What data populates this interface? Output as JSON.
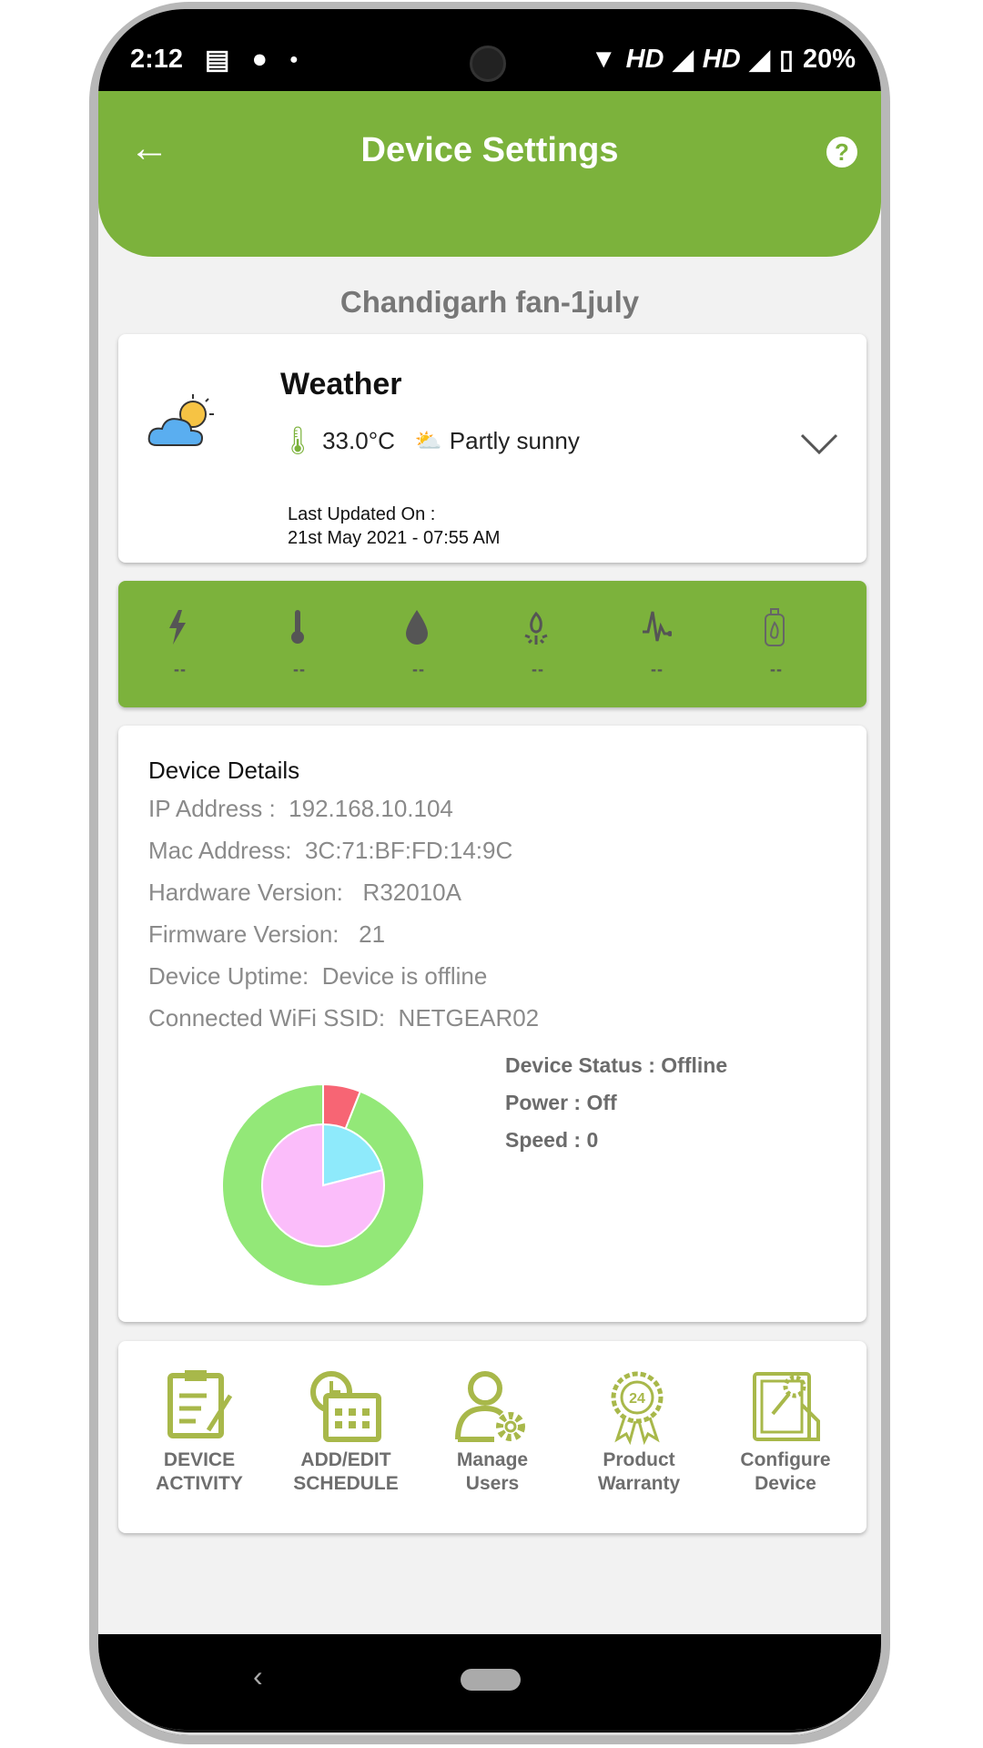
{
  "status_bar": {
    "time": "2:12",
    "network": "HD",
    "network2": "HD",
    "battery": "20%"
  },
  "header": {
    "title": "Device Settings",
    "back_icon": "arrow-left-icon",
    "help_icon": "help-icon",
    "help_label": "?",
    "back_label": "←"
  },
  "device_name": "Chandigarh fan-1july",
  "weather": {
    "title": "Weather",
    "temperature": "33.0°C",
    "condition": "Partly sunny",
    "updated_label": "Last Updated On :",
    "updated_value": "21st May 2021 - 07:55 AM"
  },
  "sensors": [
    {
      "icon": "lightning-icon",
      "value": "--"
    },
    {
      "icon": "thermometer-icon",
      "value": "--"
    },
    {
      "icon": "water-drop-icon",
      "value": "--"
    },
    {
      "icon": "fire-icon",
      "value": "--"
    },
    {
      "icon": "pulse-icon",
      "value": "--"
    },
    {
      "icon": "gas-cylinder-icon",
      "value": "--"
    }
  ],
  "details": {
    "heading": "Device Details",
    "rows": [
      "IP Address :  192.168.10.104",
      "Mac Address:  3C:71:BF:FD:14:9C",
      "Hardware Version:   R32010A",
      "Firmware Version:   21",
      "Device Uptime:  Device is offline",
      "Connected WiFi SSID:  NETGEAR02"
    ],
    "status": [
      "Device Status : Offline",
      "Power : Off",
      "Speed : 0"
    ]
  },
  "chart_data": {
    "type": "pie",
    "rings": [
      {
        "ring": "outer",
        "values": [
          6,
          94
        ],
        "colors": [
          "#f76574",
          "#93e878"
        ]
      },
      {
        "ring": "inner",
        "values": [
          21,
          79
        ],
        "colors": [
          "#8eeafb",
          "#fbbdfa"
        ]
      }
    ]
  },
  "menu": [
    {
      "label1": "DEVICE",
      "label2": "ACTIVITY",
      "icon": "clipboard-icon"
    },
    {
      "label1": "ADD/EDIT",
      "label2": "SCHEDULE",
      "icon": "calendar-clock-icon"
    },
    {
      "label1": "Manage",
      "label2": "Users",
      "icon": "user-gear-icon"
    },
    {
      "label1": "Product",
      "label2": "Warranty",
      "icon": "warranty-badge-icon",
      "badge": "24"
    },
    {
      "label1": "Configure",
      "label2": "Device",
      "icon": "configure-device-icon"
    }
  ],
  "colors": {
    "accent": "#7cb23c",
    "menu_icon": "#a8b84a"
  }
}
